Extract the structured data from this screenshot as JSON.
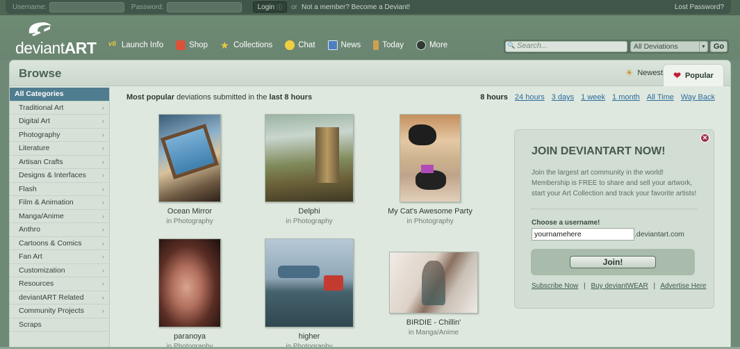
{
  "login": {
    "username_label": "Username:",
    "password_label": "Password:",
    "login_button": "Login",
    "or_text": "or",
    "become_link": "Not a member? Become a Deviant!",
    "lost_password": "Lost Password?"
  },
  "brand": {
    "logo_text_bold": "deviant",
    "logo_text_caps": "ART"
  },
  "nav": [
    {
      "label": "Launch Info",
      "icon": "v6-icon",
      "color": "#e0c740"
    },
    {
      "label": "Shop",
      "icon": "shop-icon",
      "color": "#d9533a"
    },
    {
      "label": "Collections",
      "icon": "star-icon",
      "color": "#f1c93a"
    },
    {
      "label": "Chat",
      "icon": "smiley-icon",
      "color": "#f0d040"
    },
    {
      "label": "News",
      "icon": "news-icon",
      "color": "#4d7fc0"
    },
    {
      "label": "Today",
      "icon": "today-icon",
      "color": "#d0a050"
    },
    {
      "label": "More",
      "icon": "more-icon",
      "color": "#2e3a33"
    }
  ],
  "search": {
    "placeholder": "Search...",
    "scope": "All Deviations",
    "go": "Go"
  },
  "browse": {
    "title": "Browse",
    "tab_newest": "Newest",
    "tab_popular": "Popular"
  },
  "categories": [
    {
      "label": "All Categories",
      "active": true
    },
    {
      "label": "Traditional Art"
    },
    {
      "label": "Digital Art"
    },
    {
      "label": "Photography"
    },
    {
      "label": "Literature"
    },
    {
      "label": "Artisan Crafts"
    },
    {
      "label": "Designs & Interfaces"
    },
    {
      "label": "Flash"
    },
    {
      "label": "Film & Animation"
    },
    {
      "label": "Manga/Anime"
    },
    {
      "label": "Anthro"
    },
    {
      "label": "Cartoons & Comics"
    },
    {
      "label": "Fan Art"
    },
    {
      "label": "Customization"
    },
    {
      "label": "Resources"
    },
    {
      "label": "deviantART Related"
    },
    {
      "label": "Community Projects"
    },
    {
      "label": "Scraps"
    }
  ],
  "headline": {
    "part1": "Most popular",
    "part2": " deviations submitted in the ",
    "part3": "last 8 hours"
  },
  "time_filters": [
    "8 hours",
    "24 hours",
    "3 days",
    "1 week",
    "1 month",
    "All Time",
    "Way Back"
  ],
  "deviations": [
    {
      "title": "Ocean Mirror",
      "category": "in Photography"
    },
    {
      "title": "Delphi",
      "category": "in Photography"
    },
    {
      "title": "My Cat's Awesome Party",
      "category": "in Photography"
    },
    {
      "title": "paranoya",
      "category": "in Photography"
    },
    {
      "title": "higher",
      "category": "in Photography"
    },
    {
      "title": "BIRDIE - Chillin'",
      "category": "in Manga/Anime"
    }
  ],
  "join": {
    "title": "JOIN DEVIANTART NOW!",
    "text": "Join the largest art community in the world! Membership is FREE to share and sell your artwork, start your Art Collection and track your favorite artists!",
    "label": "Choose a username!",
    "input_value": "yournamehere",
    "domain_suffix": ".deviantart.com",
    "button": "Join!",
    "links": [
      "Subscribe Now",
      "Buy deviantWEAR",
      "Advertise Here"
    ],
    "separator": "|"
  }
}
